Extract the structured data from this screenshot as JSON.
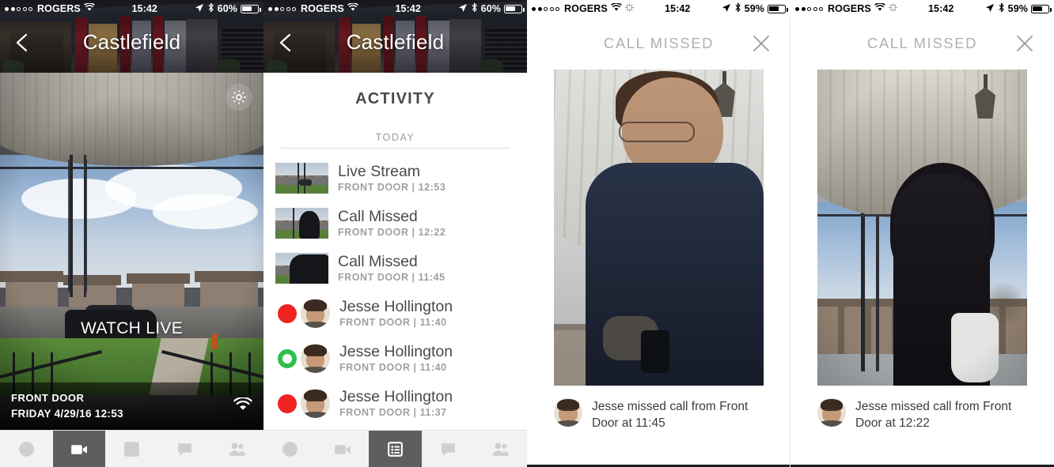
{
  "panels": {
    "live": {
      "statusbar": {
        "carrier": "ROGERS",
        "time": "15:42",
        "battery": "60%",
        "signal_filled": 2,
        "signal_total": 5,
        "icons": [
          "wifi-icon",
          "location-arrow-icon",
          "bluetooth-icon",
          "battery-icon"
        ]
      },
      "header": {
        "title": "Castlefield",
        "back": "back-chevron-icon"
      },
      "video": {
        "gear": "gear-icon",
        "watch_live": "WATCH LIVE",
        "footer_line1": "FRONT DOOR",
        "footer_line2": "FRIDAY 4/29/16 12:53",
        "wifi": "wifi-icon"
      },
      "tabs": [
        {
          "name": "record",
          "icon": "circle-icon",
          "active": false
        },
        {
          "name": "camera",
          "icon": "video-camera-icon",
          "active": true
        },
        {
          "name": "activity",
          "icon": "list-icon",
          "active": false
        },
        {
          "name": "messages",
          "icon": "speech-bubble-icon",
          "active": false
        },
        {
          "name": "contacts",
          "icon": "people-icon",
          "active": false
        }
      ]
    },
    "activity": {
      "statusbar": {
        "carrier": "ROGERS",
        "time": "15:42",
        "battery": "60%",
        "signal_filled": 2,
        "signal_total": 5
      },
      "header": {
        "title": "Castlefield",
        "back": "back-chevron-icon"
      },
      "section_title": "ACTIVITY",
      "day_divider": "TODAY",
      "items": [
        {
          "kind": "thumb",
          "title": "Live Stream",
          "meta": "FRONT DOOR | 12:53",
          "thumb": "street-view-thumbnail"
        },
        {
          "kind": "thumb",
          "title": "Call Missed",
          "meta": "FRONT DOOR | 12:22",
          "thumb": "person-silhouette-thumbnail"
        },
        {
          "kind": "thumb",
          "title": "Call Missed",
          "meta": "FRONT DOOR | 11:45",
          "thumb": "person-closeup-thumbnail"
        },
        {
          "kind": "avatar",
          "title": "Jesse Hollington",
          "meta": "FRONT DOOR | 11:40",
          "indicator": "filled",
          "indicator_color": "#f02222"
        },
        {
          "kind": "avatar",
          "title": "Jesse Hollington",
          "meta": "FRONT DOOR | 11:40",
          "indicator": "ring",
          "indicator_color": "#2ec04c"
        },
        {
          "kind": "avatar",
          "title": "Jesse Hollington",
          "meta": "FRONT DOOR | 11:37",
          "indicator": "filled",
          "indicator_color": "#f02222"
        }
      ],
      "tabs": [
        {
          "name": "record",
          "icon": "circle-icon",
          "active": false
        },
        {
          "name": "camera",
          "icon": "video-camera-icon",
          "active": false
        },
        {
          "name": "activity",
          "icon": "list-icon",
          "active": true
        },
        {
          "name": "messages",
          "icon": "speech-bubble-icon",
          "active": false
        },
        {
          "name": "contacts",
          "icon": "people-icon",
          "active": false
        }
      ]
    },
    "detail_1145": {
      "statusbar": {
        "carrier": "ROGERS",
        "time": "15:42",
        "battery": "59%",
        "signal_filled": 2,
        "signal_total": 5,
        "icons": [
          "wifi-icon",
          "spinner-icon",
          "location-arrow-icon",
          "bluetooth-icon"
        ]
      },
      "title": "CALL MISSED",
      "close": "close-icon",
      "photo": "man-at-door-photo",
      "caption": "Jesse missed call from Front Door at 11:45",
      "caption_avatar": "jesse-avatar"
    },
    "detail_1222": {
      "statusbar": {
        "carrier": "ROGERS",
        "time": "15:42",
        "battery": "59%",
        "signal_filled": 2,
        "signal_total": 5,
        "icons": [
          "wifi-icon",
          "spinner-icon",
          "location-arrow-icon",
          "bluetooth-icon"
        ]
      },
      "title": "CALL MISSED",
      "close": "close-icon",
      "photo": "woman-with-bag-photo",
      "caption": "Jesse missed call from Front Door at 12:22",
      "caption_avatar": "jesse-avatar"
    }
  },
  "colors": {
    "indicator_red": "#f02222",
    "indicator_green": "#2ec04c",
    "tab_active_bg": "#5e5e5e",
    "tabbar_bg": "#f2f2f2",
    "title_gray": "#4a4a4a",
    "meta_gray": "#a0a0a0"
  }
}
